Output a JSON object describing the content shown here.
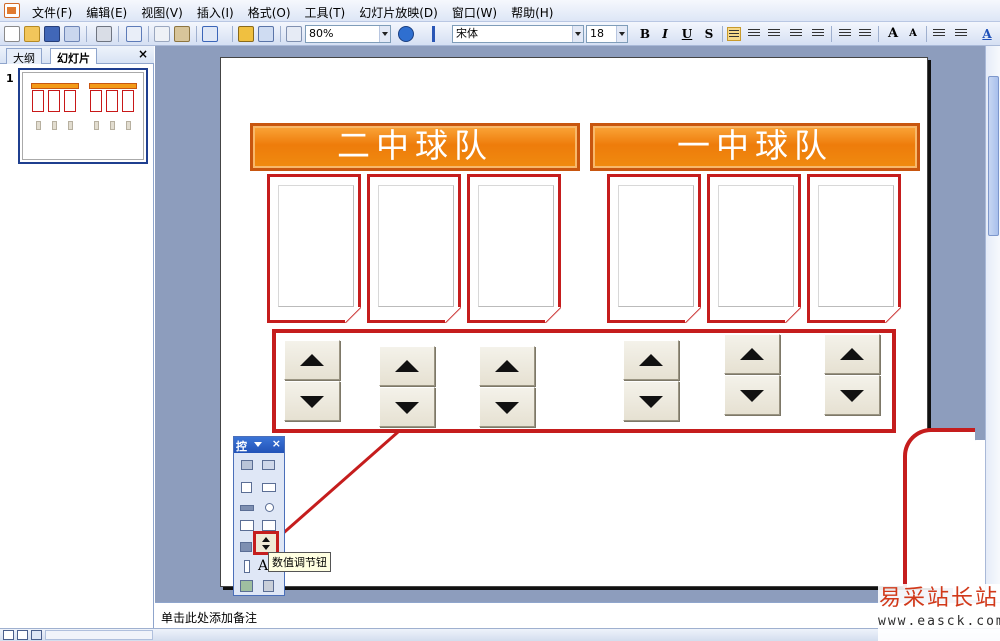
{
  "menubar": {
    "items": [
      "文件(F)",
      "编辑(E)",
      "视图(V)",
      "插入(I)",
      "格式(O)",
      "工具(T)",
      "幻灯片放映(D)",
      "窗口(W)",
      "帮助(H)"
    ]
  },
  "toolbar": {
    "zoom": "80%",
    "font_name": "宋体",
    "font_size": "18",
    "bold": "B",
    "italic": "I",
    "underline": "U",
    "shadow": "S"
  },
  "left_pane": {
    "tabs": [
      "大纲",
      "幻灯片"
    ],
    "close": "×",
    "slide_number": "1",
    "thumb_banners": [
      "二中球队",
      "一中球队"
    ]
  },
  "slide": {
    "team_left": "二中球队",
    "team_right": "一中球队"
  },
  "toolbox": {
    "title": "控",
    "close": "×",
    "tooltip": "数值调节钮"
  },
  "notes": {
    "placeholder": "单击此处添加备注"
  },
  "watermark": {
    "title": "易采站长站",
    "url": "www.easck.com"
  },
  "colors": {
    "banner_orange": "#f08b0f",
    "frame_red": "#c51d1d",
    "title_bar_blue": "#2253b8"
  }
}
